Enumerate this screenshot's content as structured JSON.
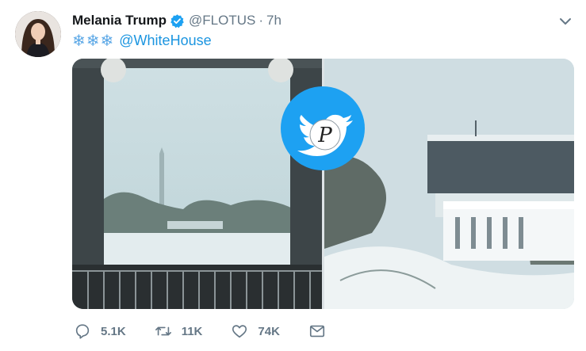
{
  "tweet": {
    "author_name": "Melania Trump",
    "verified": true,
    "handle": "@FLOTUS",
    "separator": "·",
    "time": "7h",
    "text_emoji": "❄❄❄",
    "text_mention": "@WhiteHouse"
  },
  "media": {
    "photos": [
      {
        "subject": "view-from-balcony-with-monument"
      },
      {
        "subject": "snowy-white-house-west-wing"
      }
    ],
    "overlay_logo": "bird-logo-with-p-letter"
  },
  "actions": {
    "reply_count": "5.1K",
    "retweet_count": "11K",
    "like_count": "74K"
  },
  "icons": {
    "reply": "reply-icon",
    "retweet": "retweet-icon",
    "like": "heart-icon",
    "dm": "envelope-icon",
    "caret": "chevron-down-icon",
    "verified": "verified-badge-icon"
  },
  "colors": {
    "link": "#1b95e0",
    "muted": "#657786",
    "verified": "#1da1f2",
    "snowflake": "#5aa7e6"
  }
}
